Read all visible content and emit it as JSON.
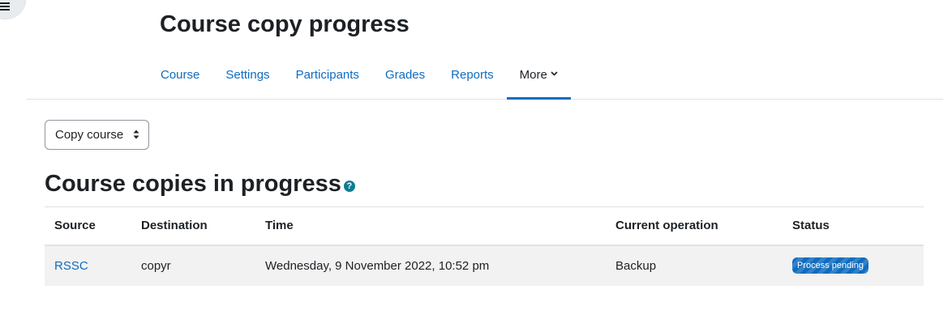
{
  "page": {
    "title": "Course copy progress"
  },
  "nav": {
    "items": [
      {
        "label": "Course"
      },
      {
        "label": "Settings"
      },
      {
        "label": "Participants"
      },
      {
        "label": "Grades"
      },
      {
        "label": "Reports"
      },
      {
        "label": "More",
        "active": true
      }
    ]
  },
  "select": {
    "value": "Copy course"
  },
  "section": {
    "title": "Course copies in progress",
    "help_icon": "question-circle-icon"
  },
  "table": {
    "headers": [
      "Source",
      "Destination",
      "Time",
      "Current operation",
      "Status"
    ],
    "rows": [
      {
        "source": "RSSC",
        "destination": "copyr",
        "time": "Wednesday, 9 November 2022, 10:52 pm",
        "operation": "Backup",
        "status": "Process pending"
      }
    ]
  },
  "colors": {
    "accent": "#0f6cbf",
    "help_icon": "#0f7c92",
    "row_background": "#f2f2f2"
  }
}
